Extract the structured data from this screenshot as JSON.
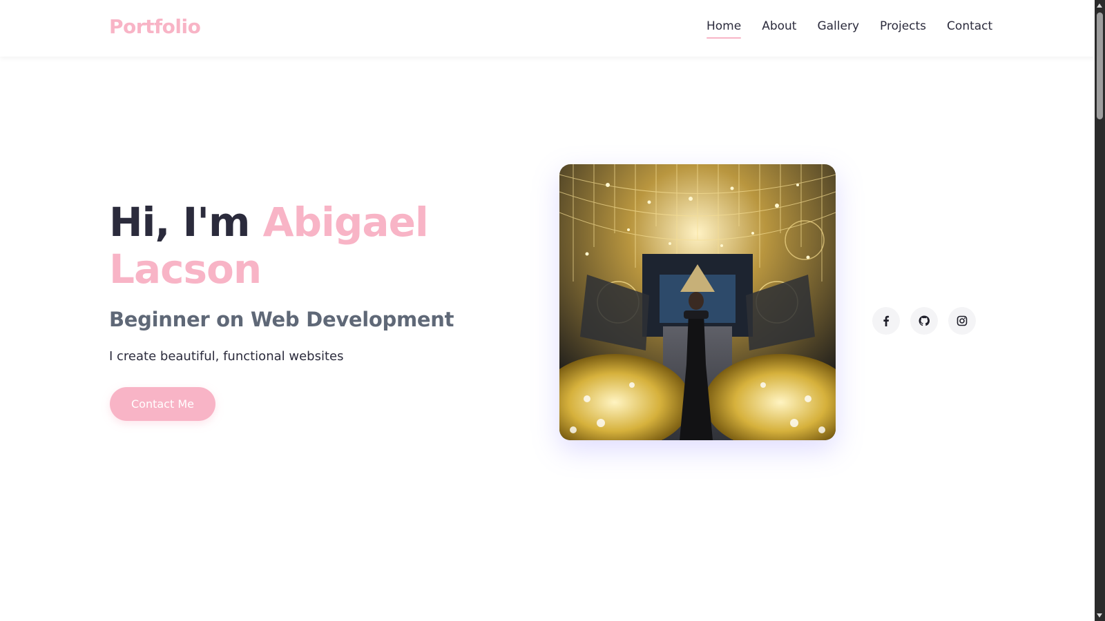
{
  "brand": {
    "logo": "Portfolio",
    "accent_color": "#f8b4c6"
  },
  "nav": {
    "items": [
      {
        "label": "Home",
        "active": true
      },
      {
        "label": "About",
        "active": false
      },
      {
        "label": "Gallery",
        "active": false
      },
      {
        "label": "Projects",
        "active": false
      },
      {
        "label": "Contact",
        "active": false
      }
    ]
  },
  "hero": {
    "greeting": "Hi, I'm",
    "name": "Abigael Lacson",
    "subtitle": "Beginner on Web Development",
    "description": "I create beautiful, functional websites",
    "cta_label": "Contact Me"
  },
  "socials": [
    {
      "icon": "facebook-icon"
    },
    {
      "icon": "github-icon"
    },
    {
      "icon": "instagram-icon"
    }
  ],
  "colors": {
    "text": "#2b2b3c",
    "subtitle": "#5f6877",
    "background": "#ffffff"
  }
}
